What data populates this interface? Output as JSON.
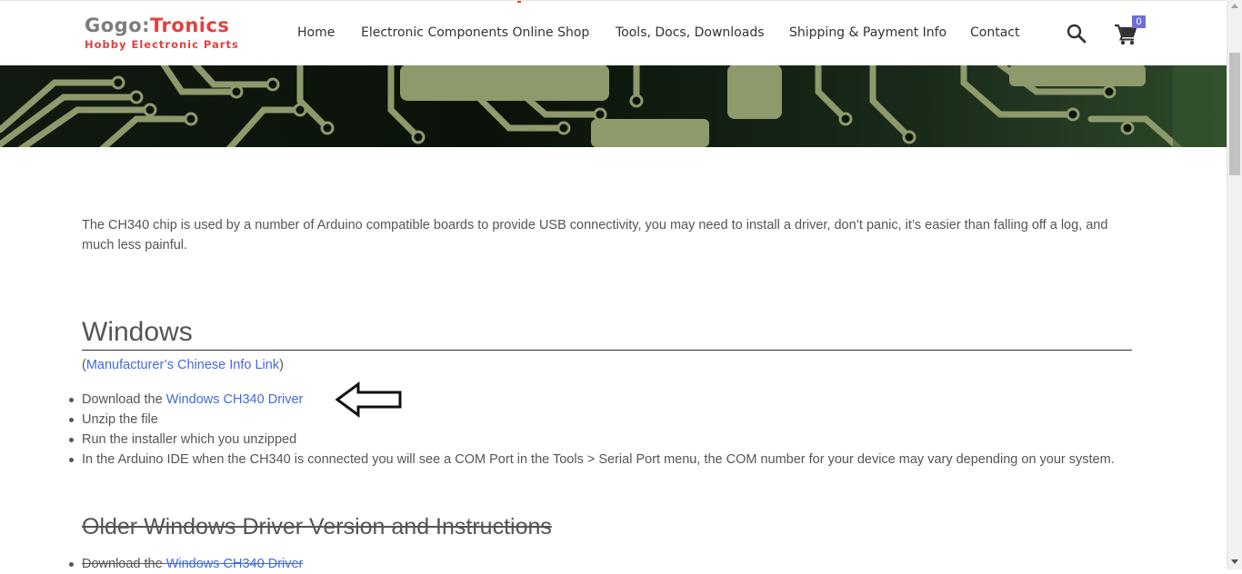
{
  "header": {
    "logo_part1": "Gogo:",
    "logo_part2": "Tronics",
    "logo_tagline": "Hobby Electronic Parts",
    "nav": [
      {
        "label": "Home"
      },
      {
        "label": "Electronic Components Online Shop"
      },
      {
        "label": "Tools, Docs, Downloads"
      },
      {
        "label": "Shipping & Payment Info"
      },
      {
        "label": "Contact"
      }
    ],
    "search_icon": "search-icon",
    "cart_icon": "shopping-cart-icon",
    "cart_count": "0"
  },
  "colors": {
    "brand_red": "#e0413f",
    "brand_grey": "#7d7d7d",
    "link": "#4169e1",
    "cart_badge": "#6f6fd6"
  },
  "main": {
    "intro": "The CH340 chip is used by a number of Arduino compatible boards to provide USB connectivity, you may need to install a driver, don’t panic, it’s easier than falling off a log, and much less painful.",
    "windows_heading": "Windows",
    "mfr_open": "(",
    "mfr_link": "Manufacturer’s Chinese Info Link",
    "mfr_close": ")",
    "steps": {
      "download_prefix": "Download the ",
      "download_link": "Windows CH340 Driver",
      "unzip": "Unzip the file",
      "run": "Run the installer which you unzipped",
      "ide": "In the Arduino IDE when the CH340 is connected you will see a COM Port in the Tools > Serial Port menu, the COM number for your device may vary depending on your system."
    },
    "older_heading": "Older Windows Driver Version and Instructions",
    "older_steps": {
      "download_prefix": "Download the ",
      "download_link": "Windows CH340 Driver"
    }
  }
}
